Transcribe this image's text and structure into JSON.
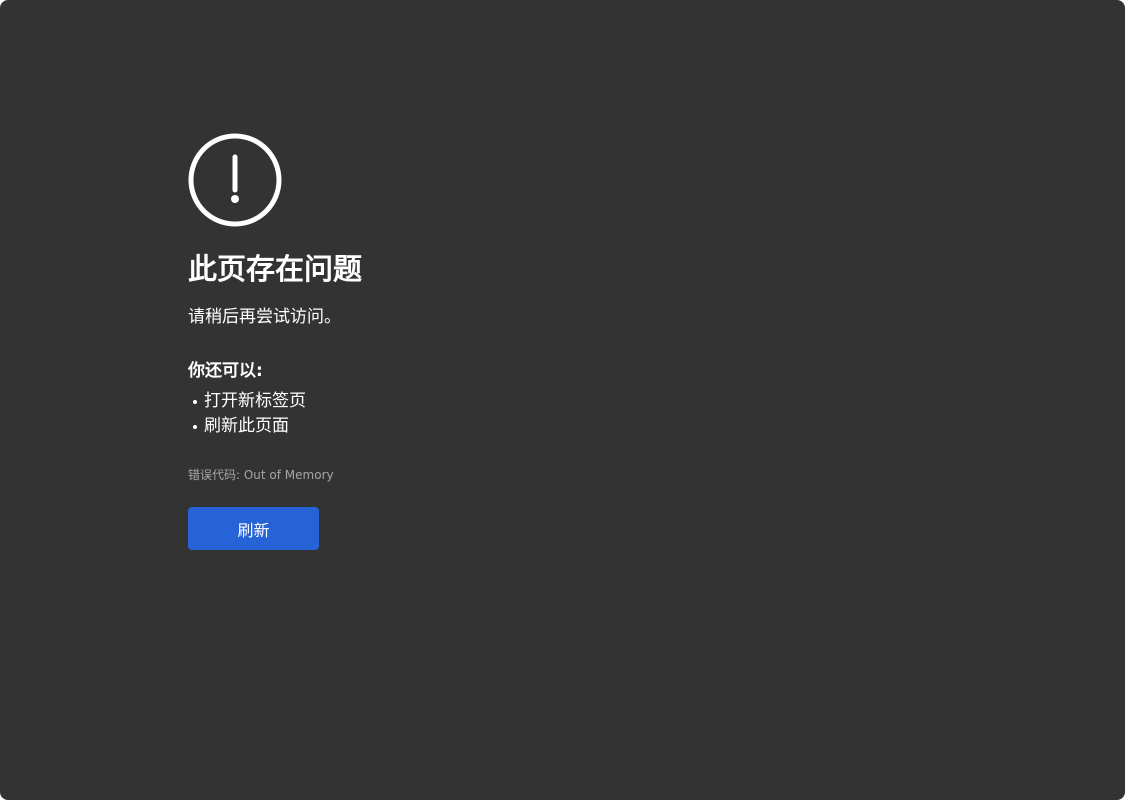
{
  "error_page": {
    "icon": "exclamation-circle-icon",
    "title": "此页存在问题",
    "message": "请稍后再尝试访问。",
    "suggestions_heading": "你还可以:",
    "suggestions": [
      {
        "label": "打开新标签页"
      },
      {
        "label": "刷新此页面"
      }
    ],
    "error_code": "错误代码: Out of Memory",
    "refresh_button_label": "刷新"
  },
  "colors": {
    "background": "#333333",
    "text": "#ffffff",
    "secondary_text": "#a6a6a6",
    "accent": "#2563d6"
  }
}
